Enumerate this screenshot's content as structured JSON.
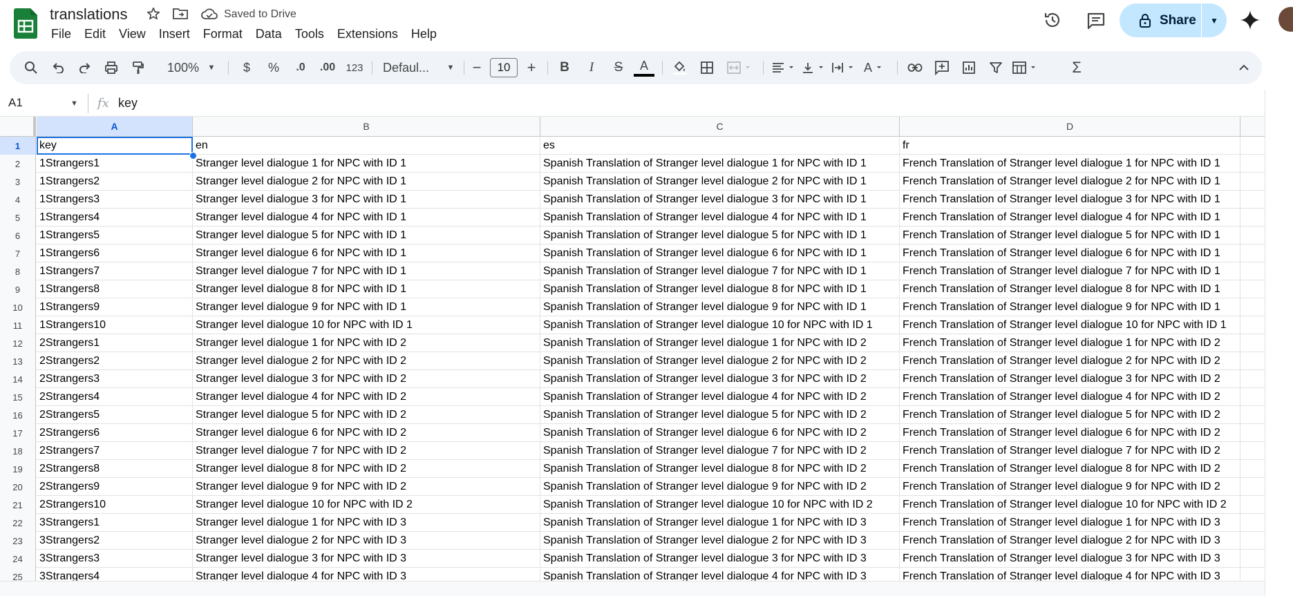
{
  "app": {
    "title": "translations",
    "saved_status": "Saved to Drive",
    "menu": [
      "File",
      "Edit",
      "View",
      "Insert",
      "Format",
      "Data",
      "Tools",
      "Extensions",
      "Help"
    ],
    "share_label": "Share",
    "colors": {
      "accent": "#1a73e8",
      "share_bg": "#c2e7ff",
      "toolbar_bg": "#f0f4f9",
      "sheets_green": "#188038"
    }
  },
  "toolbar": {
    "zoom": "100%",
    "currency": "$",
    "percent": "%",
    "decrease_decimal": ".0",
    "increase_decimal": ".00",
    "more_formats": "123",
    "font": "Defaul...",
    "font_size": "10",
    "minus": "−",
    "plus": "+",
    "bold": "B",
    "italic": "I",
    "strike": "S",
    "text_color": "A",
    "text_rotation": "A",
    "functions": "Σ"
  },
  "formula_bar": {
    "name_box": "A1",
    "fx": "fx",
    "value": "key"
  },
  "sheet": {
    "columns": [
      "A",
      "B",
      "C",
      "D"
    ],
    "selected_cell": "A1",
    "row_numbers": [
      "1",
      "2",
      "3",
      "4",
      "5",
      "6",
      "7",
      "8",
      "9",
      "10",
      "11",
      "12",
      "13",
      "14",
      "15",
      "16",
      "17",
      "18",
      "19",
      "20",
      "21",
      "22",
      "23",
      "24",
      "25"
    ],
    "rows": [
      [
        "key",
        "en",
        "es",
        "fr"
      ],
      [
        "1Strangers1",
        "Stranger level dialogue 1 for NPC with ID 1",
        "Spanish Translation of Stranger level dialogue 1 for NPC with ID 1",
        "French Translation of Stranger level dialogue 1 for NPC with ID 1"
      ],
      [
        "1Strangers2",
        "Stranger level dialogue 2 for NPC with ID 1",
        "Spanish Translation of Stranger level dialogue 2 for NPC with ID 1",
        "French Translation of Stranger level dialogue 2 for NPC with ID 1"
      ],
      [
        "1Strangers3",
        "Stranger level dialogue 3 for NPC with ID 1",
        "Spanish Translation of Stranger level dialogue 3 for NPC with ID 1",
        "French Translation of Stranger level dialogue 3 for NPC with ID 1"
      ],
      [
        "1Strangers4",
        "Stranger level dialogue 4 for NPC with ID 1",
        "Spanish Translation of Stranger level dialogue 4 for NPC with ID 1",
        "French Translation of Stranger level dialogue 4 for NPC with ID 1"
      ],
      [
        "1Strangers5",
        "Stranger level dialogue 5 for NPC with ID 1",
        "Spanish Translation of Stranger level dialogue 5 for NPC with ID 1",
        "French Translation of Stranger level dialogue 5 for NPC with ID 1"
      ],
      [
        "1Strangers6",
        "Stranger level dialogue 6 for NPC with ID 1",
        "Spanish Translation of Stranger level dialogue 6 for NPC with ID 1",
        "French Translation of Stranger level dialogue 6 for NPC with ID 1"
      ],
      [
        "1Strangers7",
        "Stranger level dialogue 7 for NPC with ID 1",
        "Spanish Translation of Stranger level dialogue 7 for NPC with ID 1",
        "French Translation of Stranger level dialogue 7 for NPC with ID 1"
      ],
      [
        "1Strangers8",
        "Stranger level dialogue 8 for NPC with ID 1",
        "Spanish Translation of Stranger level dialogue 8 for NPC with ID 1",
        "French Translation of Stranger level dialogue 8 for NPC with ID 1"
      ],
      [
        "1Strangers9",
        "Stranger level dialogue 9 for NPC with ID 1",
        "Spanish Translation of Stranger level dialogue 9 for NPC with ID 1",
        "French Translation of Stranger level dialogue 9 for NPC with ID 1"
      ],
      [
        "1Strangers10",
        "Stranger level dialogue 10 for NPC with ID 1",
        "Spanish Translation of Stranger level dialogue 10 for NPC with ID 1",
        "French Translation of Stranger level dialogue 10 for NPC with ID 1"
      ],
      [
        "2Strangers1",
        "Stranger level dialogue 1 for NPC with ID 2",
        "Spanish Translation of Stranger level dialogue 1 for NPC with ID 2",
        "French Translation of Stranger level dialogue 1 for NPC with ID 2"
      ],
      [
        "2Strangers2",
        "Stranger level dialogue 2 for NPC with ID 2",
        "Spanish Translation of Stranger level dialogue 2 for NPC with ID 2",
        "French Translation of Stranger level dialogue 2 for NPC with ID 2"
      ],
      [
        "2Strangers3",
        "Stranger level dialogue 3 for NPC with ID 2",
        "Spanish Translation of Stranger level dialogue 3 for NPC with ID 2",
        "French Translation of Stranger level dialogue 3 for NPC with ID 2"
      ],
      [
        "2Strangers4",
        "Stranger level dialogue 4 for NPC with ID 2",
        "Spanish Translation of Stranger level dialogue 4 for NPC with ID 2",
        "French Translation of Stranger level dialogue 4 for NPC with ID 2"
      ],
      [
        "2Strangers5",
        "Stranger level dialogue 5 for NPC with ID 2",
        "Spanish Translation of Stranger level dialogue 5 for NPC with ID 2",
        "French Translation of Stranger level dialogue 5 for NPC with ID 2"
      ],
      [
        "2Strangers6",
        "Stranger level dialogue 6 for NPC with ID 2",
        "Spanish Translation of Stranger level dialogue 6 for NPC with ID 2",
        "French Translation of Stranger level dialogue 6 for NPC with ID 2"
      ],
      [
        "2Strangers7",
        "Stranger level dialogue 7 for NPC with ID 2",
        "Spanish Translation of Stranger level dialogue 7 for NPC with ID 2",
        "French Translation of Stranger level dialogue 7 for NPC with ID 2"
      ],
      [
        "2Strangers8",
        "Stranger level dialogue 8 for NPC with ID 2",
        "Spanish Translation of Stranger level dialogue 8 for NPC with ID 2",
        "French Translation of Stranger level dialogue 8 for NPC with ID 2"
      ],
      [
        "2Strangers9",
        "Stranger level dialogue 9 for NPC with ID 2",
        "Spanish Translation of Stranger level dialogue 9 for NPC with ID 2",
        "French Translation of Stranger level dialogue 9 for NPC with ID 2"
      ],
      [
        "2Strangers10",
        "Stranger level dialogue 10 for NPC with ID 2",
        "Spanish Translation of Stranger level dialogue 10 for NPC with ID 2",
        "French Translation of Stranger level dialogue 10 for NPC with ID 2"
      ],
      [
        "3Strangers1",
        "Stranger level dialogue 1 for NPC with ID 3",
        "Spanish Translation of Stranger level dialogue 1 for NPC with ID 3",
        "French Translation of Stranger level dialogue 1 for NPC with ID 3"
      ],
      [
        "3Strangers2",
        "Stranger level dialogue 2 for NPC with ID 3",
        "Spanish Translation of Stranger level dialogue 2 for NPC with ID 3",
        "French Translation of Stranger level dialogue 2 for NPC with ID 3"
      ],
      [
        "3Strangers3",
        "Stranger level dialogue 3 for NPC with ID 3",
        "Spanish Translation of Stranger level dialogue 3 for NPC with ID 3",
        "French Translation of Stranger level dialogue 3 for NPC with ID 3"
      ],
      [
        "3Strangers4",
        "Stranger level dialogue 4 for NPC with ID 3",
        "Spanish Translation of Stranger level dialogue 4 for NPC with ID 3",
        "French Translation of Stranger level dialogue 4 for NPC with ID 3"
      ]
    ]
  }
}
